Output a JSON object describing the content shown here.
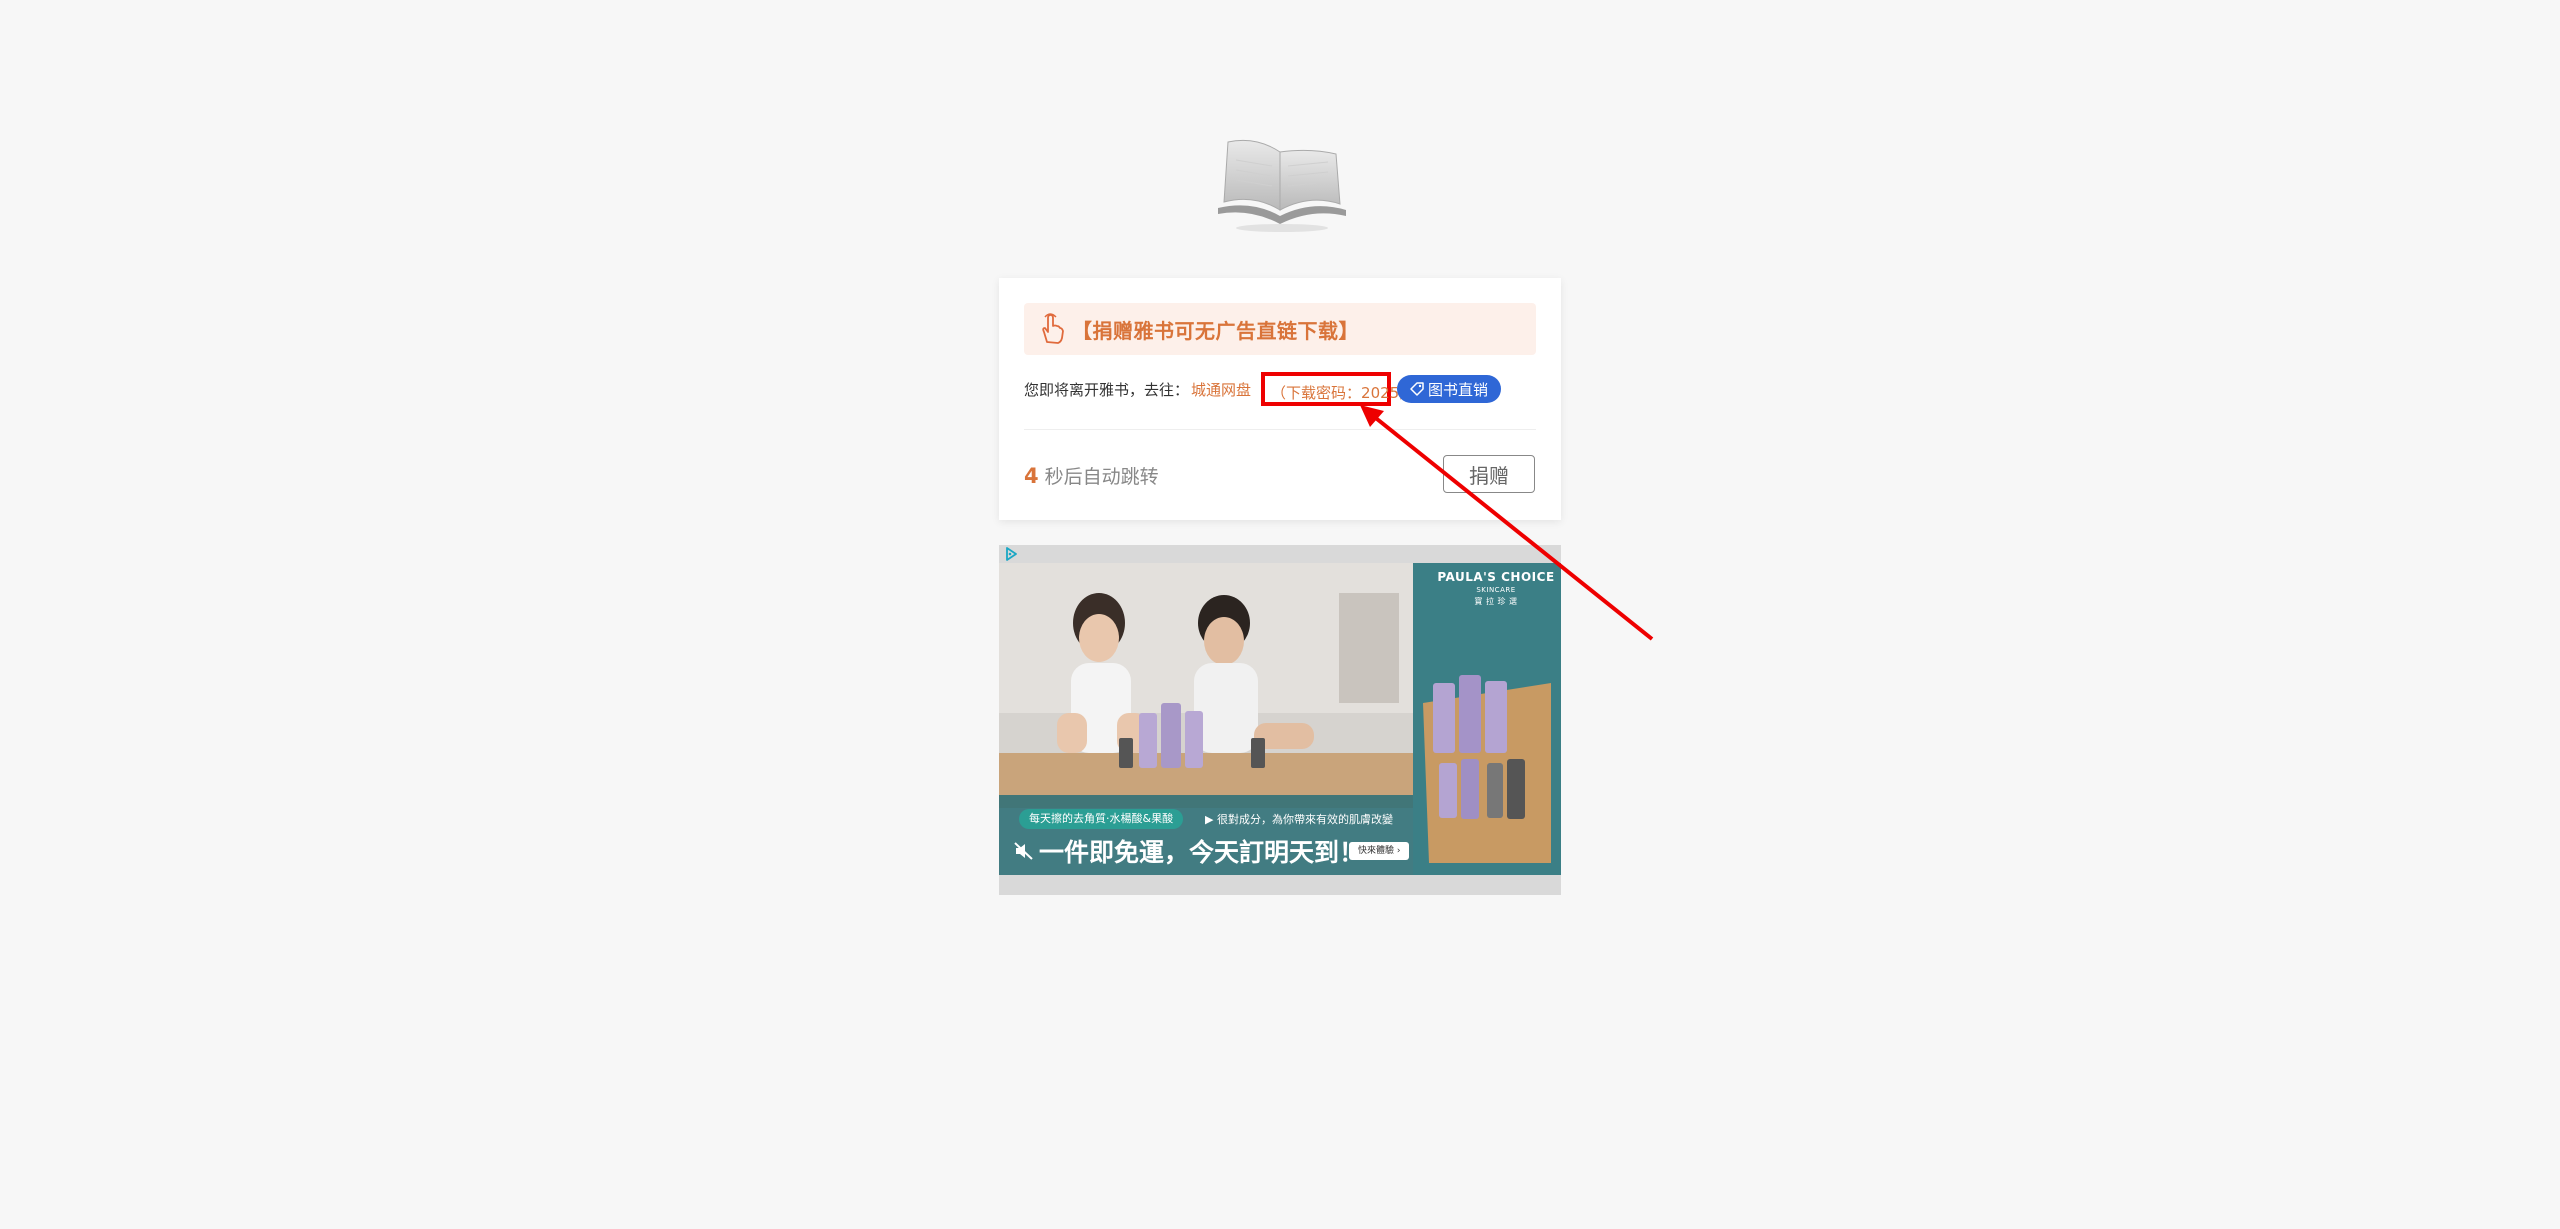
{
  "promo": {
    "text": "【捐赠雅书可无广告直链下载】"
  },
  "redirect": {
    "prefix": "您即将离开雅书，去往：",
    "destination": "城通网盘",
    "password": "（下载密码：2025）",
    "tag_label": "图书直销"
  },
  "countdown": {
    "seconds": "4",
    "suffix": "秒后自动跳转"
  },
  "donate": {
    "label": "捐赠"
  },
  "ad": {
    "brand": "PAULA'S CHOICE",
    "brand_sub": "SKINCARE",
    "brand_zh": "寶 拉 珍 選",
    "pill": "每天擦的去角質·水楊酸&果酸",
    "sub": "▶ 很對成分，為你帶來有效的肌膚改變",
    "headline": "一件即免運，今天訂明天到！",
    "cta": "快來體驗 ›"
  },
  "colors": {
    "accent": "#d9743a",
    "tag_blue": "#2f67d6",
    "highlight_red": "#ee0000"
  }
}
